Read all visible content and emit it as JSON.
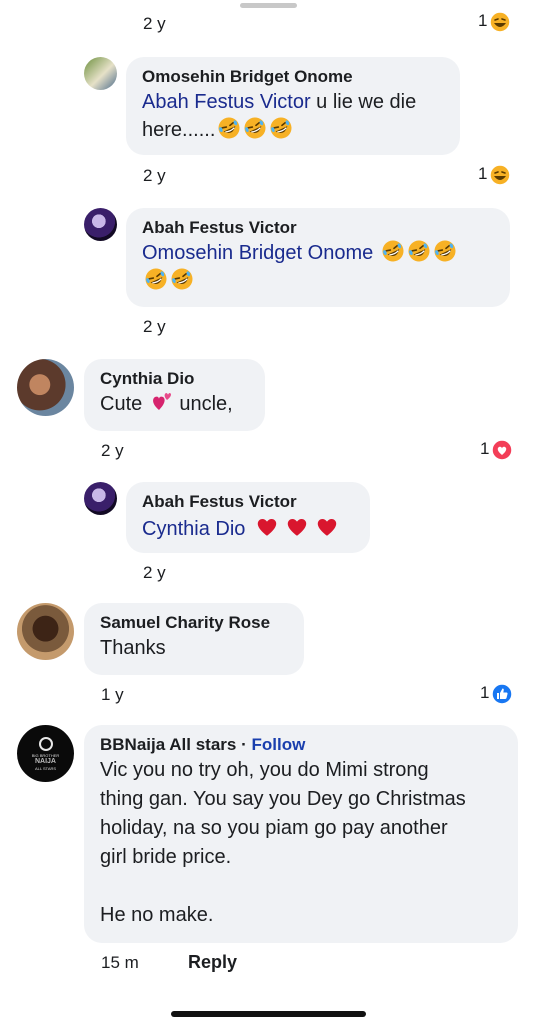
{
  "thread": {
    "top": {
      "time": "2 y",
      "reaction_count": "1",
      "reaction": "haha-icon"
    },
    "comments": [
      {
        "author": "Omosehin Bridget Onome",
        "mention": "Abah Festus Victor",
        "text_line1_rest": " u lie we die",
        "text_line2": "here......",
        "emoji_count": 3,
        "time": "2 y",
        "reaction_count": "1",
        "reaction": "haha-icon"
      },
      {
        "author": "Abah Festus Victor",
        "mention": "Omosehin Bridget Onome",
        "emoji_count": 5,
        "time": "2 y"
      },
      {
        "author": "Cynthia Dio",
        "text_before": "Cute ",
        "text_after": " uncle,",
        "emoji": "two-hearts-icon",
        "time": "2 y",
        "reaction_count": "1",
        "reaction": "love-icon"
      },
      {
        "author": "Abah Festus Victor",
        "mention": "Cynthia Dio",
        "emoji": "red-heart-icon",
        "emoji_count": 3,
        "time": "2 y"
      },
      {
        "author": "Samuel Charity Rose",
        "text": "Thanks",
        "time": "1 y",
        "reaction_count": "1",
        "reaction": "like-icon"
      },
      {
        "author": "BBNaija All stars",
        "separator": " · ",
        "follow": "Follow",
        "lines": [
          "Vic you no try oh, you do Mimi strong",
          "thing gan. You say you Dey go Christmas",
          "holiday, na so you piam go pay another",
          "girl bride price."
        ],
        "last_line": "He no make.",
        "avatar_text": [
          "BIG BROTHER",
          "NAIJA",
          "ALL STARS"
        ],
        "time": "15 m",
        "reply": "Reply"
      }
    ]
  },
  "colors": {
    "mention": "#1a2b8e",
    "bubble": "#f0f2f5",
    "like": "#1877f2",
    "love": "#f33e58",
    "haha": "#f7b125"
  }
}
